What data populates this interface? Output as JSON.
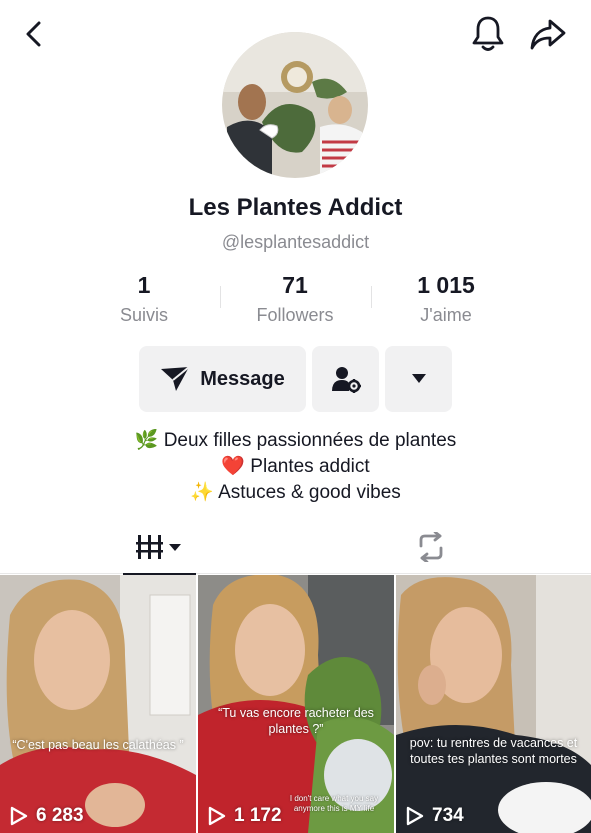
{
  "header": {
    "back_icon": "chevron-left-icon",
    "bell_icon": "bell-icon",
    "share_icon": "share-arrow-icon"
  },
  "profile": {
    "name": "Les Plantes Addict",
    "handle": "@lesplantesaddict"
  },
  "stats": [
    {
      "value": "1",
      "label": "Suivis"
    },
    {
      "value": "71",
      "label": "Followers"
    },
    {
      "value": "1 015",
      "label": "J'aime"
    }
  ],
  "actions": {
    "message_label": "Message",
    "message_icon": "send-icon",
    "friend_icon": "user-settings-icon",
    "more_icon": "caret-down-icon"
  },
  "bio": [
    {
      "emoji": "🌿",
      "text": "Deux filles passionnées de plantes"
    },
    {
      "emoji": "❤️",
      "text": "Plantes addict"
    },
    {
      "emoji": "✨",
      "text": "Astuces & good vibes"
    }
  ],
  "tabs": {
    "videos_icon": "grid-bars-icon",
    "reposts_icon": "repost-icon"
  },
  "videos": [
    {
      "caption": "“C'est pas beau les calathéas ”",
      "views": "6 283"
    },
    {
      "caption": "“Tu vas encore racheter des plantes ?”",
      "small_caption": "I don't care what you say anymore this is MY life",
      "views": "1 172"
    },
    {
      "caption": "pov: tu rentres de vacances et toutes tes plantes sont mortes",
      "views": "734"
    }
  ],
  "colors": {
    "text": "#161823",
    "secondary_text": "#8a8b91",
    "button_bg": "#f1f1f2"
  }
}
